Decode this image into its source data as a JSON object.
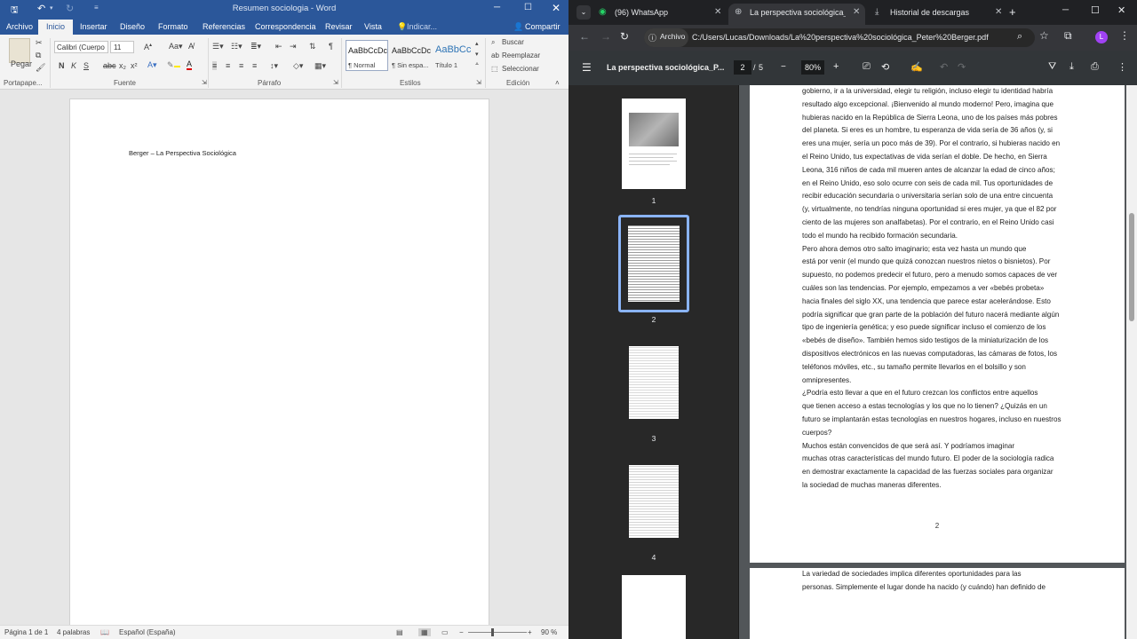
{
  "word": {
    "title": "Resumen sociologia - Word",
    "tabs": [
      "Archivo",
      "Inicio",
      "Insertar",
      "Diseño",
      "Formato",
      "Referencias",
      "Correspondencia",
      "Revisar",
      "Vista"
    ],
    "tell_me": "Indicar...",
    "share": "Compartir",
    "font_name": "Calibri (Cuerpo",
    "font_size": "11",
    "styles": [
      {
        "preview": "AaBbCcDc",
        "name": "¶ Normal"
      },
      {
        "preview": "AaBbCcDc",
        "name": "¶ Sin espa..."
      },
      {
        "preview": "AaBbCc",
        "name": "Título 1"
      }
    ],
    "edit": {
      "find": "Buscar",
      "replace": "Reemplazar",
      "select": "Seleccionar"
    },
    "groups": {
      "clipboard": "Portapape...",
      "font": "Fuente",
      "paragraph": "Párrafo",
      "styles": "Estilos",
      "edit": "Edición"
    },
    "paste": "Pegar",
    "doc_text": "Berger – La Perspectiva Sociológica",
    "status": {
      "page": "Página 1 de 1",
      "words": "4 palabras",
      "lang": "Español (España)",
      "zoom": "90 %"
    }
  },
  "chrome": {
    "tabs": [
      {
        "label": "(96) WhatsApp"
      },
      {
        "label": "La perspectiva sociológica_Pet"
      },
      {
        "label": "Historial de descargas"
      }
    ],
    "site_chip": "Archivo",
    "url": "C:/Users/Lucas/Downloads/La%20perspectiva%20sociológica_Peter%20Berger.pdf"
  },
  "pdf": {
    "title": "La perspectiva sociológica_P...",
    "page": "2",
    "total": "5",
    "zoom": "80%",
    "thumbs": [
      "1",
      "2",
      "3",
      "4"
    ],
    "lines": [
      "gobierno, ir a la universidad, elegir tu religión, incluso elegir tu identidad habría",
      "resultado algo excepcional. ¡Bienvenido al mundo moderno! Pero, imagina que",
      "hubieras nacido en la República de Sierra Leona, uno de los países más pobres",
      "del planeta. Si eres es un hombre, tu esperanza de vida sería de 36 años (y, si",
      "eres una mujer, sería un poco más de 39). Por el contrario, si hubieras nacido en",
      "el Reino Unido, tus expectativas de vida serían el doble. De hecho, en Sierra",
      "Leona, 316 niños de cada mil mueren antes de alcanzar la edad de cinco años;",
      "en el Reino Unido, eso solo ocurre con seis de cada mil. Tus oportunidades de",
      "recibir educación secundaria o universitaria serían solo de una entre cincuenta",
      "(y, virtualmente, no tendrías ninguna oportunidad si eres mujer, ya que el 82 por",
      "ciento de las mujeres son analfabetas). Por el contrario, en el Reino Unido casi",
      "todo el mundo ha recibido formación secundaria.",
      "      Pero ahora demos otro salto imaginario; esta vez hasta un mundo que",
      "está por venir (el mundo que quizá conozcan nuestros nietos o bisnietos). Por",
      "supuesto, no podemos predecir el futuro, pero a menudo somos capaces de ver",
      "cuáles son las tendencias. Por ejemplo, empezamos a ver «bebés probeta»",
      "hacia finales del siglo XX, una tendencia que parece estar acelerándose. Esto",
      "podría significar que gran parte de la población del futuro nacerá mediante algún",
      "tipo de ingeniería genética; y eso puede significar incluso el comienzo de los",
      "«bebés de diseño». También hemos sido testigos de la miniaturización de los",
      "dispositivos electrónicos en las nuevas computadoras, las cámaras de fotos, los",
      "teléfonos móviles, etc., su tamaño permite llevarlos en el bolsillo y son",
      "omnipresentes.",
      "      ¿Podría esto llevar a que en el futuro crezcan los conflictos entre aquellos",
      "que tienen acceso a estas tecnologías y los que no lo tienen? ¿Quizás en un",
      "futuro se implantarán estas tecnologías en nuestros hogares, incluso en nuestros",
      "cuerpos?",
      "      Muchos están convencidos de que será así. Y podríamos imaginar",
      "muchas otras características del mundo futuro. El poder de la sociología radica",
      "en demostrar exactamente la capacidad de las fuerzas sociales para organizar",
      "la sociedad de muchas maneras diferentes."
    ],
    "page_number": "2",
    "next_lines": [
      "      La variedad de sociedades implica diferentes oportunidades para las",
      "personas. Simplemente el lugar donde ha nacido (y cuándo) han definido de"
    ]
  }
}
